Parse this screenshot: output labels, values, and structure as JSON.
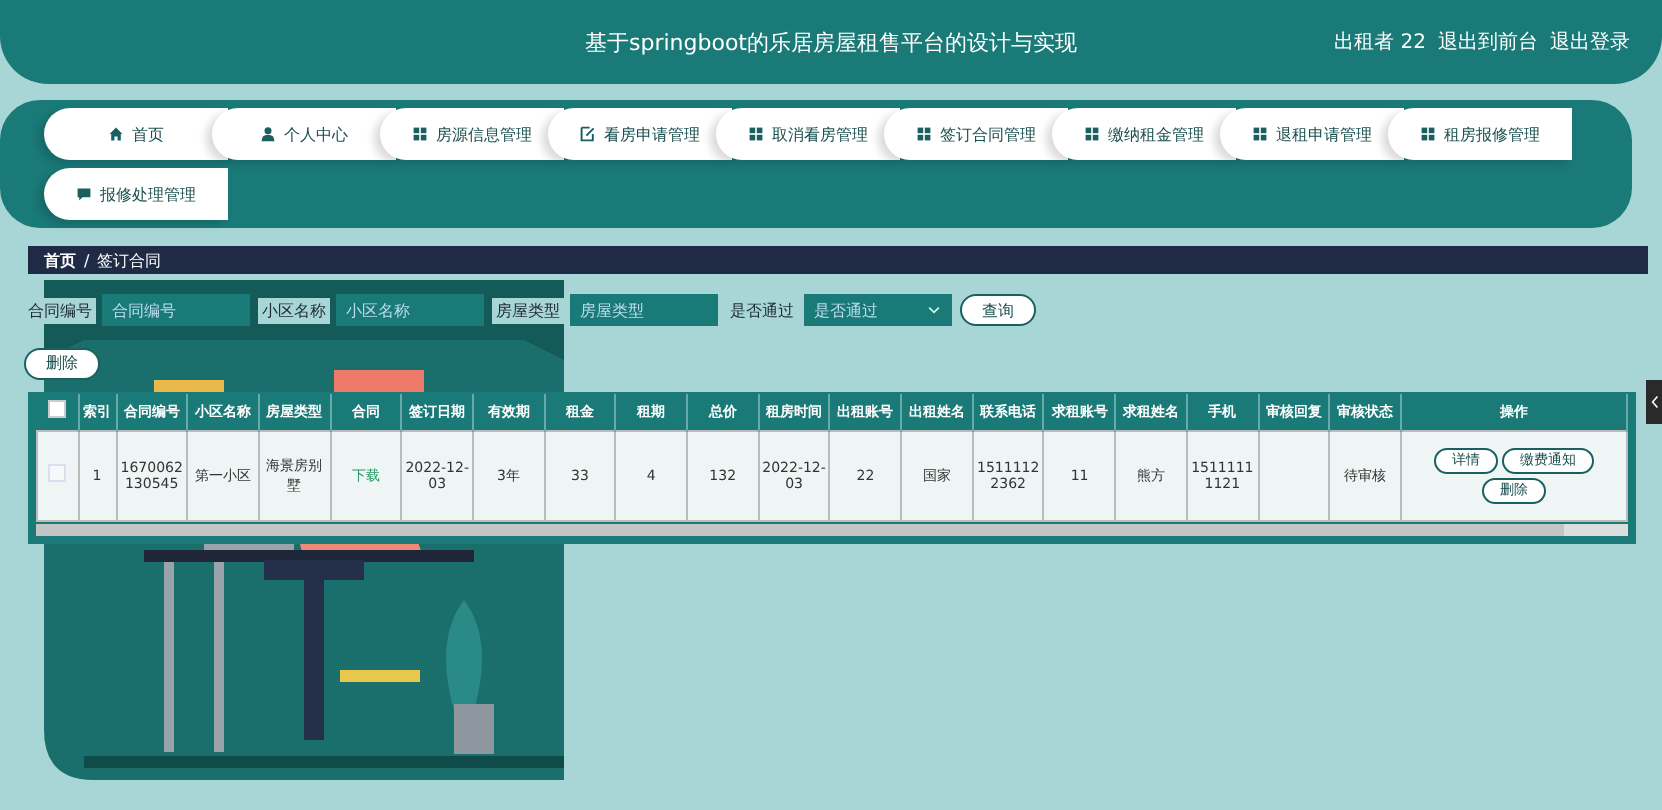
{
  "header": {
    "title": "基于springboot的乐居房屋租售平台的设计与实现",
    "user": "出租者 22",
    "links": [
      "退出到前台",
      "退出登录"
    ]
  },
  "nav": [
    {
      "label": "首页",
      "kind": "home"
    },
    {
      "label": "个人中心",
      "kind": "user"
    },
    {
      "label": "房源信息管理",
      "kind": "grid"
    },
    {
      "label": "看房申请管理",
      "kind": "edit"
    },
    {
      "label": "取消看房管理",
      "kind": "grid"
    },
    {
      "label": "签订合同管理",
      "kind": "grid"
    },
    {
      "label": "缴纳租金管理",
      "kind": "grid"
    },
    {
      "label": "退租申请管理",
      "kind": "grid"
    },
    {
      "label": "租房报修管理",
      "kind": "grid"
    },
    {
      "label": "报修处理管理",
      "kind": "chat"
    }
  ],
  "breadcrumb": {
    "items": [
      "首页",
      "签订合同"
    ],
    "separator": "/"
  },
  "filters": [
    {
      "label": "合同编号",
      "placeholder": "合同编号",
      "kind": "input"
    },
    {
      "label": "小区名称",
      "placeholder": "小区名称",
      "kind": "input"
    },
    {
      "label": "房屋类型",
      "placeholder": "房屋类型",
      "kind": "input"
    },
    {
      "label": "是否通过",
      "placeholder": "是否通过",
      "kind": "select"
    }
  ],
  "search_button": "查询",
  "delete_button": "删除",
  "table": {
    "select_all_checked": false,
    "columns": [
      "索引",
      "合同编号",
      "小区名称",
      "房屋类型",
      "合同",
      "签订日期",
      "有效期",
      "租金",
      "租期",
      "总价",
      "租房时间",
      "出租账号",
      "出租姓名",
      "联系电话",
      "求租账号",
      "求租姓名",
      "手机",
      "审核回复",
      "审核状态",
      "操作"
    ],
    "rows": [
      {
        "checked": false,
        "cells": [
          "1",
          "1670062130545",
          "第一小区",
          "海景房别墅",
          "下载",
          "2022-12-03",
          "3年",
          "33",
          "4",
          "132",
          "2022-12-03",
          "22",
          "国家",
          "15111122362",
          "11",
          "熊方",
          "15111111121",
          "",
          "待审核"
        ],
        "actions": [
          "详情",
          "缴费通知",
          "删除"
        ]
      }
    ]
  }
}
